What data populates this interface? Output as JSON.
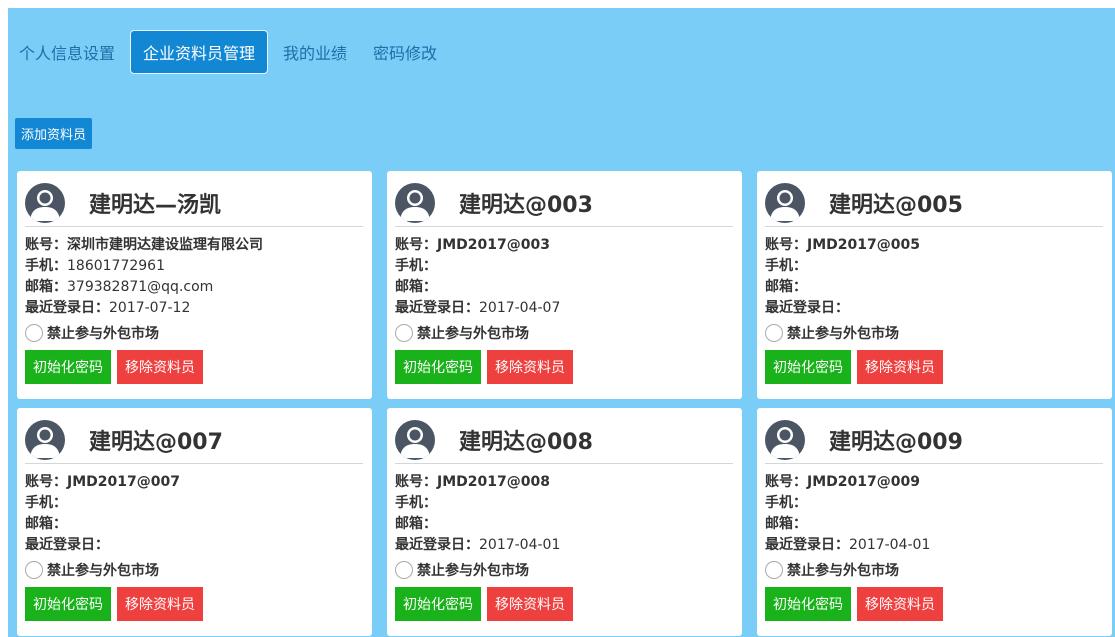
{
  "tabs": [
    {
      "label": "个人信息设置",
      "active": false
    },
    {
      "label": "企业资料员管理",
      "active": true
    },
    {
      "label": "我的业绩",
      "active": false
    },
    {
      "label": "密码修改",
      "active": false
    }
  ],
  "add_button": "添加资料员",
  "labels": {
    "account": "账号：",
    "phone": "手机：",
    "email": "邮箱：",
    "last_login": "最近登录日：",
    "ban_outsourcing": "禁止参与外包市场",
    "reset_password": "初始化密码",
    "remove": "移除资料员"
  },
  "cards": [
    {
      "name": "建明达—汤凯",
      "account": "深圳市建明达建设监理有限公司",
      "phone": "18601772961",
      "email": "379382871@qq.com",
      "last_login": "2017-07-12"
    },
    {
      "name": "建明达@003",
      "account": "JMD2017@003",
      "phone": "",
      "email": "",
      "last_login": "2017-04-07"
    },
    {
      "name": "建明达@005",
      "account": "JMD2017@005",
      "phone": "",
      "email": "",
      "last_login": ""
    },
    {
      "name": "建明达@007",
      "account": "JMD2017@007",
      "phone": "",
      "email": "",
      "last_login": ""
    },
    {
      "name": "建明达@008",
      "account": "JMD2017@008",
      "phone": "",
      "email": "",
      "last_login": "2017-04-01"
    },
    {
      "name": "建明达@009",
      "account": "JMD2017@009",
      "phone": "",
      "email": "",
      "last_login": "2017-04-01"
    }
  ],
  "colors": {
    "panel_bg": "#79cdf7",
    "primary": "#1287d4",
    "success": "#19b21a",
    "danger": "#ef4040"
  }
}
